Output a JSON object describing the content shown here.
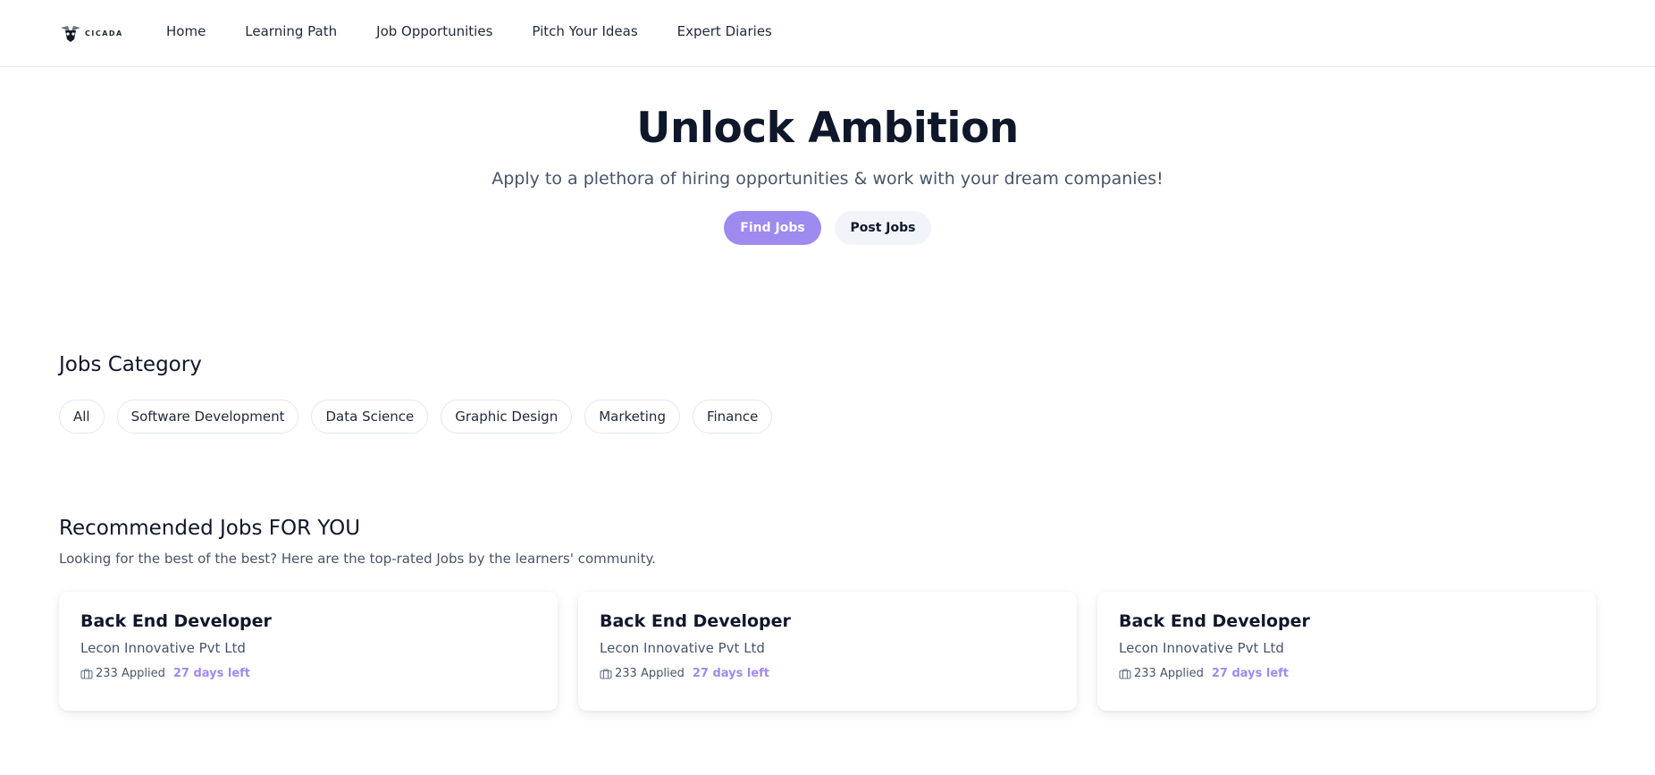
{
  "nav": {
    "logo_text": "CICADA",
    "links": [
      "Home",
      "Learning Path",
      "Job Opportunities",
      "Pitch Your Ideas",
      "Expert Diaries"
    ]
  },
  "hero": {
    "title": "Unlock Ambition",
    "subtitle": "Apply to a plethora of hiring opportunities & work with your dream companies!",
    "primary_button": "Find Jobs",
    "secondary_button": "Post Jobs"
  },
  "categories": {
    "title": "Jobs Category",
    "items": [
      "All",
      "Software Development",
      "Data Science",
      "Graphic Design",
      "Marketing",
      "Finance"
    ]
  },
  "recommended": {
    "title": "Recommended Jobs FOR YOU",
    "subtitle": "Looking for the best of the best? Here are the top-rated Jobs by the learners' community.",
    "jobs": [
      {
        "title": "Back End Developer",
        "company": "Lecon Innovative Pvt Ltd",
        "applied": "233 Applied",
        "days_left": "27 days left"
      },
      {
        "title": "Back End Developer",
        "company": "Lecon Innovative Pvt Ltd",
        "applied": "233 Applied",
        "days_left": "27 days left"
      },
      {
        "title": "Back End Developer",
        "company": "Lecon Innovative Pvt Ltd",
        "applied": "233 Applied",
        "days_left": "27 days left"
      }
    ]
  },
  "colors": {
    "accent": "#9f8af0",
    "text_dark": "#0f172a",
    "text_muted": "#475569"
  },
  "icons": {
    "logo": "cicada-logo-icon",
    "job_meta": "briefcase-icon"
  }
}
